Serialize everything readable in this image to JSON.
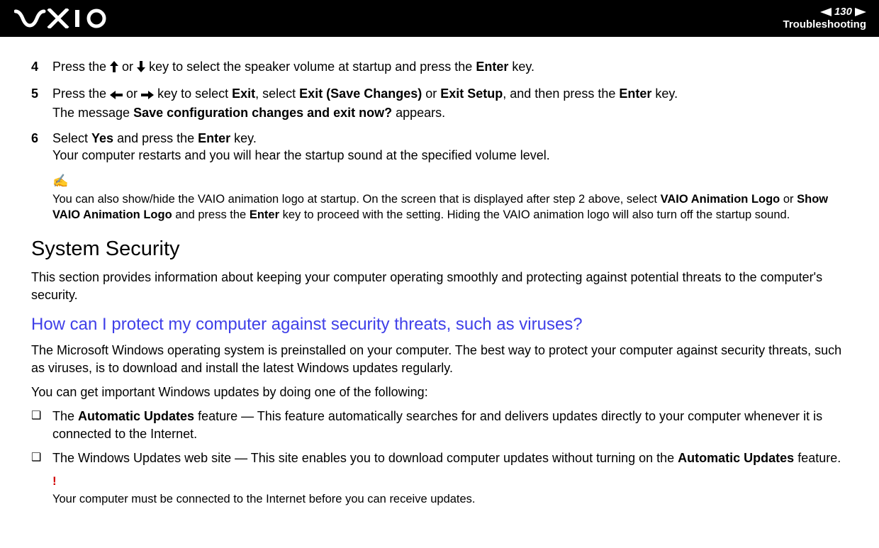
{
  "header": {
    "page_number": "130",
    "section": "Troubleshooting"
  },
  "steps": [
    {
      "num": "4",
      "pre": "Press the ",
      "mid": " or ",
      "post": " key to select the speaker volume at startup and press the ",
      "bold_end": "Enter",
      "tail": " key."
    },
    {
      "num": "5",
      "pre": "Press the ",
      "mid": " or ",
      "post1": " key to select ",
      "b1": "Exit",
      "post2": ", select ",
      "b2": "Exit (Save Changes)",
      "post3": " or ",
      "b3": "Exit Setup",
      "post4": ", and then press the ",
      "b4": "Enter",
      "post5": " key.",
      "line2a": "The message ",
      "line2b": "Save configuration changes and exit now?",
      "line2c": " appears."
    },
    {
      "num": "6",
      "a": "Select ",
      "b1": "Yes",
      "c": " and press the ",
      "b2": "Enter",
      "d": " key.",
      "line2": "Your computer restarts and you will hear the startup sound at the specified volume level."
    }
  ],
  "note": {
    "icon": "✍",
    "t1": "You can also show/hide the VAIO animation logo at startup. On the screen that is displayed after step 2 above, select ",
    "b1": "VAIO Animation Logo",
    "t2": " or ",
    "b2": "Show VAIO Animation Logo",
    "t3": " and press the ",
    "b3": "Enter",
    "t4": " key to proceed with the setting. Hiding the VAIO animation logo will also turn off the startup sound."
  },
  "section_heading": "System Security",
  "section_intro": "This section provides information about keeping your computer operating smoothly and protecting against potential threats to the computer's security.",
  "question": "How can I protect my computer against security threats, such as viruses?",
  "answer_p1": "The Microsoft Windows operating system is preinstalled on your computer. The best way to protect your computer against security threats, such as viruses, is to download and install the latest Windows updates regularly.",
  "answer_p2": "You can get important Windows updates by doing one of the following:",
  "bullets": [
    {
      "a": "The ",
      "b1": "Automatic Updates",
      "c": " feature — This feature automatically searches for and delivers updates directly to your computer whenever it is connected to the Internet."
    },
    {
      "a": "The Windows Updates web site — This site enables you to download computer updates without turning on the ",
      "b1": "Automatic Updates",
      "c": " feature."
    }
  ],
  "warning": {
    "mark": "!",
    "text": "Your computer must be connected to the Internet before you can receive updates."
  }
}
